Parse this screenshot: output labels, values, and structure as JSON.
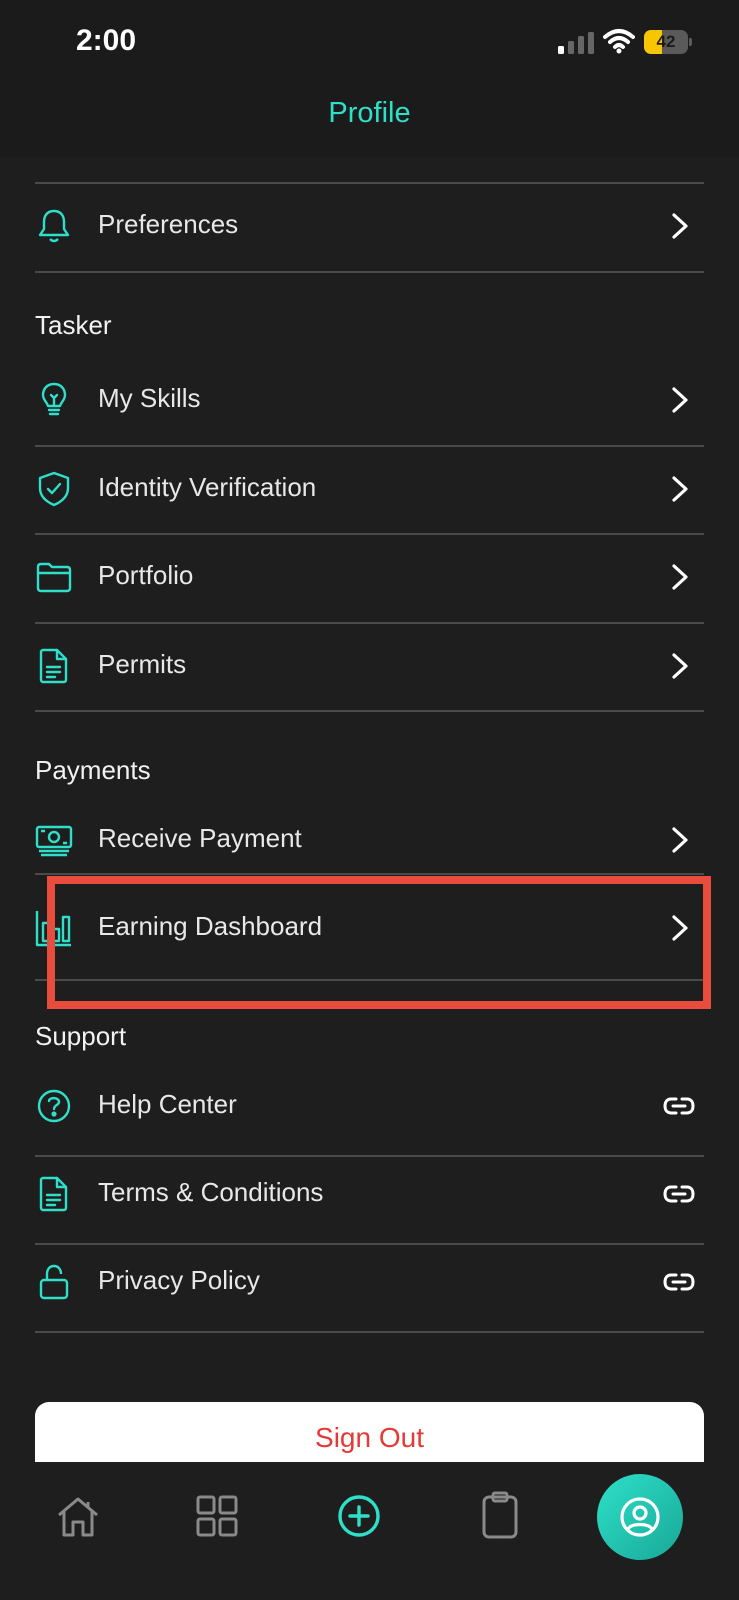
{
  "status_bar": {
    "time": "2:00",
    "battery_level": "42",
    "battery_percent": 42
  },
  "header": {
    "title": "Profile"
  },
  "sections": {
    "preferences": {
      "label": "Preferences"
    },
    "tasker": {
      "title": "Tasker",
      "items": [
        {
          "label": "My Skills",
          "icon": "lightbulb-icon"
        },
        {
          "label": "Identity Verification",
          "icon": "shield-check-icon"
        },
        {
          "label": "Portfolio",
          "icon": "folder-icon"
        },
        {
          "label": "Permits",
          "icon": "document-icon"
        }
      ]
    },
    "payments": {
      "title": "Payments",
      "items": [
        {
          "label": "Receive Payment",
          "icon": "cash-icon"
        },
        {
          "label": "Earning Dashboard",
          "icon": "bar-chart-icon"
        }
      ]
    },
    "support": {
      "title": "Support",
      "items": [
        {
          "label": "Help Center",
          "icon": "question-circle-icon"
        },
        {
          "label": "Terms & Conditions",
          "icon": "document-icon"
        },
        {
          "label": "Privacy Policy",
          "icon": "lock-icon"
        }
      ]
    }
  },
  "sign_out": {
    "label": "Sign Out"
  },
  "bottom_nav": [
    "home-icon",
    "grid-icon",
    "plus-circle-icon",
    "clipboard-icon",
    "profile-icon"
  ],
  "colors": {
    "accent": "#2ee0c9",
    "background": "#1e1e1e",
    "danger": "#e53935",
    "highlight": "#e74c3c"
  }
}
